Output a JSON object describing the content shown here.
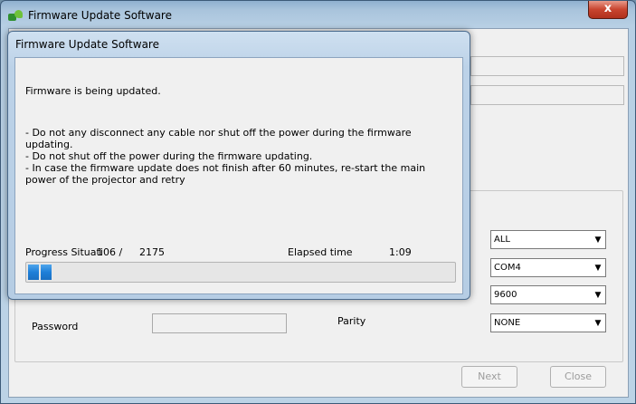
{
  "main_window": {
    "title": "Firmware Update Software",
    "close_label": "x"
  },
  "form": {
    "password_label": "Password",
    "parity_label": "Parity",
    "combos": [
      {
        "name": "combo-all",
        "value": "ALL"
      },
      {
        "name": "combo-port",
        "value": "COM4"
      },
      {
        "name": "combo-baud",
        "value": "9600"
      },
      {
        "name": "combo-parity",
        "value": "NONE"
      }
    ],
    "next_label": "Next",
    "close_label": "Close"
  },
  "dialog": {
    "title": "Firmware Update Software",
    "message": "Firmware is being updated.",
    "warnings": [
      "- Do not any disconnect any cable nor shut off the power during the firmware updating.",
      "- Do not shut off the power during the firmware updating.",
      "- In case the firmware update does not finish after 60 minutes, re-start the main power of the projector and retry"
    ],
    "progress_label": "Progress Situati",
    "progress_current": "106 /",
    "progress_total": "2175",
    "elapsed_label": "Elapsed time",
    "elapsed_value": "1:09",
    "progress_fraction": 0.0487
  }
}
